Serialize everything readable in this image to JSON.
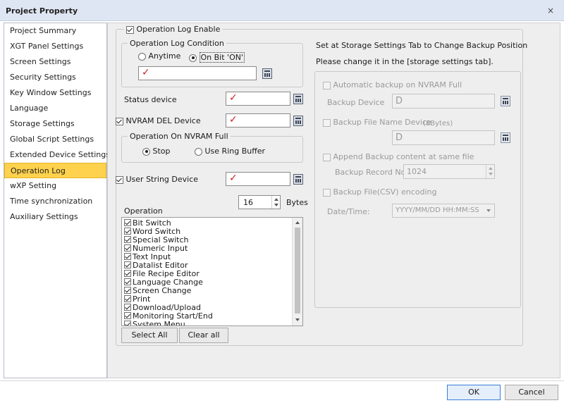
{
  "window": {
    "title": "Project Property",
    "close": "×"
  },
  "nav": {
    "items": [
      "Project Summary",
      "XGT Panel Settings",
      "Screen Settings",
      "Security Settings",
      "Key Window Settings",
      "Language",
      "Storage Settings",
      "Global Script Settings",
      "Extended Device Settings",
      "Operation Log",
      "wXP Setting",
      "Time synchronization",
      "Auxiliary Settings"
    ],
    "selected": "Operation Log"
  },
  "operation_log": {
    "enable_label": "Operation Log Enable",
    "condition_title": "Operation Log Condition",
    "anytime_label": "Anytime",
    "onbit_label": "On Bit 'ON'",
    "status_device_label": "Status device",
    "nvram_del_label": "NVRAM DEL Device",
    "nvram_full_title": "Operation On NVRAM Full",
    "stop_label": "Stop",
    "ring_buffer_label": "Use Ring Buffer",
    "user_string_label": "User String Device",
    "bytes_value": "16",
    "bytes_unit": "Bytes",
    "operation_label": "Operation",
    "select_all": "Select All",
    "clear_all": "Clear all",
    "check_mark": "✓"
  },
  "operations": [
    "Bit Switch",
    "Word Switch",
    "Special Switch",
    "Numeric Input",
    "Text Input",
    "Datalist Editor",
    "File Recipe Editor",
    "Language Change",
    "Screen Change",
    "Print",
    "Download/Upload",
    "Monitoring Start/End",
    "System Menu"
  ],
  "backup": {
    "info_line1": "Set at Storage Settings Tab to Change Backup Position",
    "info_line2": "Please change it in the [storage settings tab].",
    "auto_backup_label": "Automatic backup on NVRAM Full",
    "backup_device_label": "Backup Device",
    "backup_device_value": "D",
    "file_name_device_label": "Backup File Name Device",
    "file_name_bytes": "(8Bytes)",
    "file_name_value": "D",
    "append_label": "Append Backup content at same file",
    "record_no_label": "Backup Record No.:",
    "record_no_value": "1024",
    "csv_encoding_label": "Backup File(CSV) encoding",
    "datetime_label": "Date/Time:",
    "datetime_value": "YYYY/MM/DD HH:MM:SS"
  },
  "footer": {
    "ok": "OK",
    "cancel": "Cancel"
  }
}
